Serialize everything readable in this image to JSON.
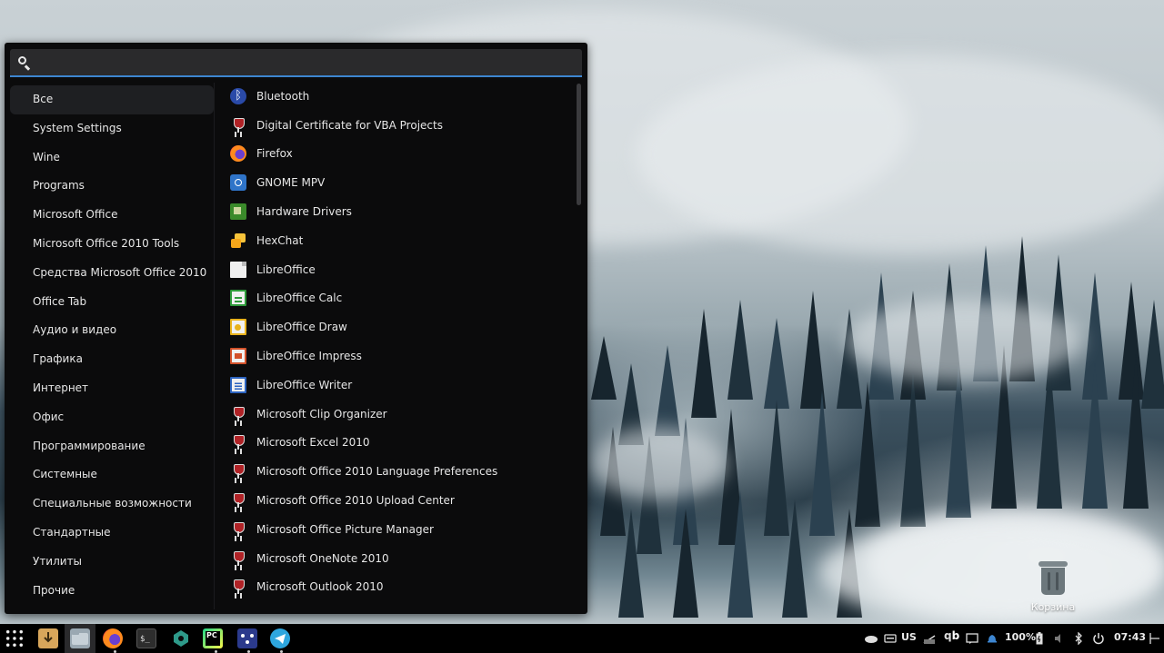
{
  "search": {
    "placeholder": "",
    "value": ""
  },
  "categories": [
    {
      "label": "Все",
      "active": true
    },
    {
      "label": "System Settings"
    },
    {
      "label": "Wine"
    },
    {
      "label": "Programs"
    },
    {
      "label": "Microsoft Office"
    },
    {
      "label": "Microsoft Office 2010 Tools"
    },
    {
      "label": "Средства Microsoft Office 2010"
    },
    {
      "label": "Office Tab"
    },
    {
      "label": "Аудио и видео"
    },
    {
      "label": "Графика"
    },
    {
      "label": "Интернет"
    },
    {
      "label": "Офис"
    },
    {
      "label": "Программирование"
    },
    {
      "label": "Системные"
    },
    {
      "label": "Специальные возможности"
    },
    {
      "label": "Стандартные"
    },
    {
      "label": "Утилиты"
    },
    {
      "label": "Прочие"
    }
  ],
  "apps": [
    {
      "label": "Bluetooth",
      "icon": "bluetooth-icon"
    },
    {
      "label": "Digital Certificate for VBA Projects",
      "icon": "wine-icon"
    },
    {
      "label": "Firefox",
      "icon": "firefox-icon"
    },
    {
      "label": "GNOME MPV",
      "icon": "gnome-mpv-icon"
    },
    {
      "label": "Hardware Drivers",
      "icon": "hardware-drivers-icon"
    },
    {
      "label": "HexChat",
      "icon": "hexchat-icon"
    },
    {
      "label": "LibreOffice",
      "icon": "libreoffice-icon"
    },
    {
      "label": "LibreOffice Calc",
      "icon": "libreoffice-calc-icon"
    },
    {
      "label": "LibreOffice Draw",
      "icon": "libreoffice-draw-icon"
    },
    {
      "label": "LibreOffice Impress",
      "icon": "libreoffice-impress-icon"
    },
    {
      "label": "LibreOffice Writer",
      "icon": "libreoffice-writer-icon"
    },
    {
      "label": "Microsoft Clip Organizer",
      "icon": "wine-icon"
    },
    {
      "label": "Microsoft Excel 2010",
      "icon": "wine-icon"
    },
    {
      "label": "Microsoft Office 2010 Language Preferences",
      "icon": "wine-icon"
    },
    {
      "label": "Microsoft Office 2010 Upload Center",
      "icon": "wine-icon"
    },
    {
      "label": "Microsoft Office Picture Manager",
      "icon": "wine-icon"
    },
    {
      "label": "Microsoft OneNote 2010",
      "icon": "wine-icon"
    },
    {
      "label": "Microsoft Outlook 2010",
      "icon": "wine-icon"
    }
  ],
  "desktop": {
    "trash_label": "Корзина"
  },
  "taskbar": {
    "apps": [
      "app-launcher-icon",
      "downloader-icon",
      "file-manager-icon",
      "firefox-icon",
      "terminal-icon",
      "wine-app-icon",
      "pycharm-icon",
      "meld-icon",
      "telegram-icon"
    ],
    "keyboard_layout": "US",
    "battery": "100%",
    "clock": "07:43"
  },
  "colors": {
    "accent": "#3d86d1",
    "menu_bg": "#0b0b0c",
    "active_category": "#1e1f22"
  }
}
